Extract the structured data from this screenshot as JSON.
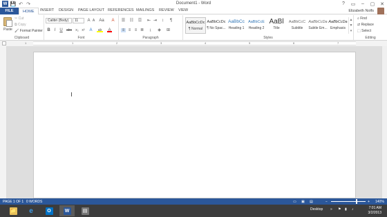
{
  "window": {
    "app_icon_letter": "W",
    "title": "Document1 - Word",
    "controls": [
      "?",
      "▭",
      "–",
      "▢",
      "✕"
    ]
  },
  "quick_access": [
    "💾",
    "↶",
    "↷"
  ],
  "tabs": {
    "file": "FILE",
    "home": "HOME",
    "items": [
      "INSERT",
      "DESIGN",
      "PAGE LAYOUT",
      "REFERENCES",
      "MAILINGS",
      "REVIEW",
      "VIEW"
    ]
  },
  "user": {
    "name": "Elizabeth Nolfs"
  },
  "ribbon": {
    "clipboard": {
      "label": "Clipboard",
      "paste": "Paste",
      "cut": "Cut",
      "copy": "Copy",
      "format_painter": "Format Painter"
    },
    "font": {
      "label": "Font",
      "family": "Calibri (Body)",
      "size": "11",
      "grow": "A",
      "shrink": "A",
      "case": "Aa",
      "clear": "A",
      "bold": "B",
      "italic": "I",
      "underline": "U",
      "strike": "abc",
      "subscript": "x₂",
      "superscript": "x²",
      "effects": "A",
      "highlight": "ab",
      "color": "A"
    },
    "paragraph": {
      "label": "Paragraph",
      "pilcrow": "¶"
    },
    "styles": {
      "label": "Styles",
      "items": [
        {
          "sample": "AaBbCcDc",
          "name": "¶ Normal"
        },
        {
          "sample": "AaBbCcDc",
          "name": "¶ No Spac..."
        },
        {
          "sample": "AaBbCc",
          "name": "Heading 1"
        },
        {
          "sample": "AaBbCcE",
          "name": "Heading 2"
        },
        {
          "sample": "AaBl",
          "name": "Title"
        },
        {
          "sample": "AaBbCcC",
          "name": "Subtitle"
        },
        {
          "sample": "AaBbCcDa",
          "name": "Subtle Em..."
        },
        {
          "sample": "AaBbCcDa",
          "name": "Emphasis"
        }
      ]
    },
    "editing": {
      "label": "Editing",
      "find": "Find",
      "replace": "Replace",
      "select": "Select"
    }
  },
  "ruler_numbers": [
    "1",
    "1",
    "2",
    "3",
    "4",
    "5",
    "6",
    "7"
  ],
  "statusbar": {
    "page": "PAGE 1 OF 1",
    "words": "0 WORDS",
    "zoom": "140%"
  },
  "taskbar": {
    "apps": [
      "📁",
      "e",
      "O",
      "W",
      "▤"
    ],
    "desktop": "Desktop",
    "time": "7:01 AM",
    "date": "3/2/2013"
  },
  "colors": {
    "accent": "#2b579a",
    "highlight": "#ffff00",
    "font_color": "#ff0000"
  }
}
